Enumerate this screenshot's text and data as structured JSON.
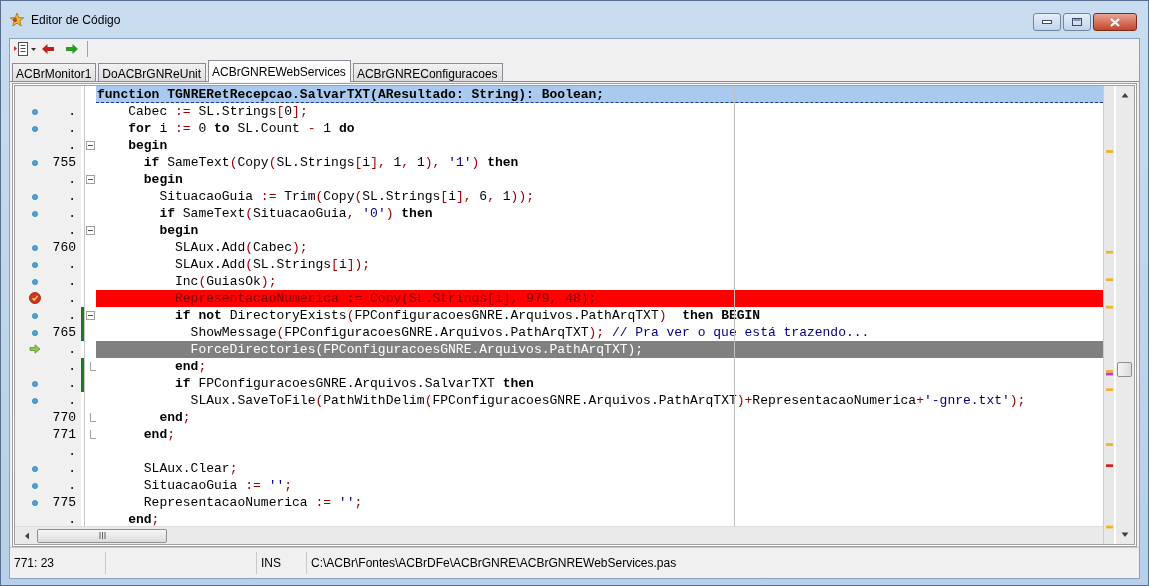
{
  "window": {
    "title": "Editor de Código"
  },
  "tabs": [
    {
      "label": "ACBrMonitor1",
      "selected": false
    },
    {
      "label": "DoACBrGNReUnit",
      "selected": false
    },
    {
      "label": "ACBrGNREWebServices",
      "selected": true
    },
    {
      "label": "ACBrGNREConfiguracoes",
      "selected": false
    }
  ],
  "editor": {
    "lines": [
      {
        "changed": false,
        "highlight": {
          "kind": "header"
        },
        "tokens": [
          {
            "kind": "keyword",
            "text": "function"
          },
          {
            "kind": "plain",
            "text": " TGNRERetRecepcao.SalvarTXT"
          },
          {
            "kind": "symbol",
            "text": "("
          },
          {
            "kind": "plain",
            "text": "AResultado"
          },
          {
            "kind": "symbol",
            "text": ":"
          },
          {
            "kind": "plain",
            "text": " String"
          },
          {
            "kind": "symbol",
            "text": "):"
          },
          {
            "kind": "plain",
            "text": " Boolean"
          },
          {
            "kind": "symbol",
            "text": ";"
          }
        ]
      },
      {
        "number": ".",
        "changed": false,
        "marker": {
          "kind": "dot"
        },
        "tokens": [
          {
            "kind": "plain",
            "text": "    Cabec "
          },
          {
            "kind": "symbol",
            "text": ":="
          },
          {
            "kind": "plain",
            "text": " SL.Strings"
          },
          {
            "kind": "symbol",
            "text": "["
          },
          {
            "kind": "plain",
            "text": "0"
          },
          {
            "kind": "symbol",
            "text": "];"
          }
        ]
      },
      {
        "number": ".",
        "changed": false,
        "marker": {
          "kind": "dot"
        },
        "tokens": [
          {
            "kind": "keyword",
            "text": "    for"
          },
          {
            "kind": "plain",
            "text": " i "
          },
          {
            "kind": "symbol",
            "text": ":="
          },
          {
            "kind": "plain",
            "text": " 0 "
          },
          {
            "kind": "keyword",
            "text": "to"
          },
          {
            "kind": "plain",
            "text": " SL.Count "
          },
          {
            "kind": "symbol",
            "text": "-"
          },
          {
            "kind": "plain",
            "text": " 1 "
          },
          {
            "kind": "keyword",
            "text": "do"
          }
        ]
      },
      {
        "number": ".",
        "changed": false,
        "fold": {
          "kind": "open"
        },
        "tokens": [
          {
            "kind": "keyword",
            "text": "    begin"
          }
        ]
      },
      {
        "number": "755",
        "changed": false,
        "marker": {
          "kind": "dot"
        },
        "tokens": [
          {
            "kind": "keyword",
            "text": "      if"
          },
          {
            "kind": "plain",
            "text": " SameText"
          },
          {
            "kind": "symbol",
            "text": "("
          },
          {
            "kind": "plain",
            "text": "Copy"
          },
          {
            "kind": "symbol",
            "text": "("
          },
          {
            "kind": "plain",
            "text": "SL.Strings"
          },
          {
            "kind": "symbol",
            "text": "["
          },
          {
            "kind": "plain",
            "text": "i"
          },
          {
            "kind": "symbol",
            "text": "],"
          },
          {
            "kind": "plain",
            "text": " 1"
          },
          {
            "kind": "symbol",
            "text": ","
          },
          {
            "kind": "plain",
            "text": " 1"
          },
          {
            "kind": "symbol",
            "text": "), "
          },
          {
            "kind": "string",
            "text": "'1'"
          },
          {
            "kind": "symbol",
            "text": ") "
          },
          {
            "kind": "keyword",
            "text": "then"
          }
        ]
      },
      {
        "number": ".",
        "changed": false,
        "fold": {
          "kind": "open"
        },
        "tokens": [
          {
            "kind": "keyword",
            "text": "      begin"
          }
        ]
      },
      {
        "number": ".",
        "changed": false,
        "marker": {
          "kind": "dot"
        },
        "tokens": [
          {
            "kind": "plain",
            "text": "        SituacaoGuia "
          },
          {
            "kind": "symbol",
            "text": ":="
          },
          {
            "kind": "plain",
            "text": " Trim"
          },
          {
            "kind": "symbol",
            "text": "("
          },
          {
            "kind": "plain",
            "text": "Copy"
          },
          {
            "kind": "symbol",
            "text": "("
          },
          {
            "kind": "plain",
            "text": "SL.Strings"
          },
          {
            "kind": "symbol",
            "text": "["
          },
          {
            "kind": "plain",
            "text": "i"
          },
          {
            "kind": "symbol",
            "text": "],"
          },
          {
            "kind": "plain",
            "text": " 6"
          },
          {
            "kind": "symbol",
            "text": ","
          },
          {
            "kind": "plain",
            "text": " 1"
          },
          {
            "kind": "symbol",
            "text": "));"
          }
        ]
      },
      {
        "number": ".",
        "changed": false,
        "marker": {
          "kind": "dot"
        },
        "tokens": [
          {
            "kind": "keyword",
            "text": "        if"
          },
          {
            "kind": "plain",
            "text": " SameText"
          },
          {
            "kind": "symbol",
            "text": "("
          },
          {
            "kind": "plain",
            "text": "SituacaoGuia"
          },
          {
            "kind": "symbol",
            "text": ", "
          },
          {
            "kind": "string",
            "text": "'0'"
          },
          {
            "kind": "symbol",
            "text": ") "
          },
          {
            "kind": "keyword",
            "text": "then"
          }
        ]
      },
      {
        "number": ".",
        "changed": false,
        "fold": {
          "kind": "open"
        },
        "tokens": [
          {
            "kind": "keyword",
            "text": "        begin"
          }
        ]
      },
      {
        "number": "760",
        "changed": false,
        "marker": {
          "kind": "dot"
        },
        "tokens": [
          {
            "kind": "plain",
            "text": "          SLAux.Add"
          },
          {
            "kind": "symbol",
            "text": "("
          },
          {
            "kind": "plain",
            "text": "Cabec"
          },
          {
            "kind": "symbol",
            "text": ");"
          }
        ]
      },
      {
        "number": ".",
        "changed": false,
        "marker": {
          "kind": "dot"
        },
        "tokens": [
          {
            "kind": "plain",
            "text": "          SLAux.Add"
          },
          {
            "kind": "symbol",
            "text": "("
          },
          {
            "kind": "plain",
            "text": "SL.Strings"
          },
          {
            "kind": "symbol",
            "text": "["
          },
          {
            "kind": "plain",
            "text": "i"
          },
          {
            "kind": "symbol",
            "text": "]);"
          }
        ]
      },
      {
        "number": ".",
        "changed": false,
        "marker": {
          "kind": "dot"
        },
        "tokens": [
          {
            "kind": "plain",
            "text": "          Inc"
          },
          {
            "kind": "symbol",
            "text": "("
          },
          {
            "kind": "plain",
            "text": "GuiasOk"
          },
          {
            "kind": "symbol",
            "text": ");"
          }
        ]
      },
      {
        "number": ".",
        "changed": false,
        "marker": {
          "kind": "breakpoint"
        },
        "highlight": {
          "kind": "error"
        },
        "tokens": [
          {
            "kind": "plain",
            "text": "          RepresentacaoNumerica "
          },
          {
            "kind": "symbol",
            "text": ":="
          },
          {
            "kind": "plain",
            "text": " Copy"
          },
          {
            "kind": "symbol",
            "text": "("
          },
          {
            "kind": "plain",
            "text": "SL.Strings"
          },
          {
            "kind": "symbol",
            "text": "["
          },
          {
            "kind": "plain",
            "text": "i"
          },
          {
            "kind": "symbol",
            "text": "],"
          },
          {
            "kind": "plain",
            "text": " 979"
          },
          {
            "kind": "symbol",
            "text": ","
          },
          {
            "kind": "plain",
            "text": " 48"
          },
          {
            "kind": "symbol",
            "text": ");"
          }
        ]
      },
      {
        "number": ".",
        "changed": true,
        "marker": {
          "kind": "dot"
        },
        "fold": {
          "kind": "open"
        },
        "tokens": [
          {
            "kind": "keyword",
            "text": "          if not"
          },
          {
            "kind": "plain",
            "text": " DirectoryExists"
          },
          {
            "kind": "symbol",
            "text": "("
          },
          {
            "kind": "plain",
            "text": "FPConfiguracoesGNRE.Arquivos.PathArqTXT"
          },
          {
            "kind": "symbol",
            "text": ")  "
          },
          {
            "kind": "keyword",
            "text": "then BEGIN"
          }
        ]
      },
      {
        "number": "765",
        "changed": true,
        "marker": {
          "kind": "dot"
        },
        "tokens": [
          {
            "kind": "plain",
            "text": "            ShowMessage"
          },
          {
            "kind": "symbol",
            "text": "("
          },
          {
            "kind": "plain",
            "text": "FPConfiguracoesGNRE.Arquivos.PathArqTXT"
          },
          {
            "kind": "symbol",
            "text": "); "
          },
          {
            "kind": "comment",
            "text": "// Pra ver o que está trazendo..."
          }
        ]
      },
      {
        "number": ".",
        "changed": false,
        "marker": {
          "kind": "arrow"
        },
        "highlight": {
          "kind": "current"
        },
        "tokens": [
          {
            "kind": "plain",
            "text": "            ForceDirectories"
          },
          {
            "kind": "symbol",
            "text": "("
          },
          {
            "kind": "plain",
            "text": "FPConfiguracoesGNRE.Arquivos.PathArqTXT"
          },
          {
            "kind": "symbol",
            "text": ");"
          }
        ]
      },
      {
        "number": ".",
        "changed": true,
        "fold": {
          "kind": "end"
        },
        "tokens": [
          {
            "kind": "keyword",
            "text": "          end"
          },
          {
            "kind": "symbol",
            "text": ";"
          }
        ]
      },
      {
        "number": ".",
        "changed": true,
        "marker": {
          "kind": "dot"
        },
        "tokens": [
          {
            "kind": "keyword",
            "text": "          if"
          },
          {
            "kind": "plain",
            "text": " FPConfiguracoesGNRE.Arquivos.SalvarTXT "
          },
          {
            "kind": "keyword",
            "text": "then"
          }
        ]
      },
      {
        "number": ".",
        "changed": false,
        "marker": {
          "kind": "dot"
        },
        "tokens": [
          {
            "kind": "plain",
            "text": "            SLAux.SaveToFile"
          },
          {
            "kind": "symbol",
            "text": "("
          },
          {
            "kind": "plain",
            "text": "PathWithDelim"
          },
          {
            "kind": "symbol",
            "text": "("
          },
          {
            "kind": "plain",
            "text": "FPConfiguracoesGNRE.Arquivos.PathArqTXT"
          },
          {
            "kind": "symbol",
            "text": ")+"
          },
          {
            "kind": "plain",
            "text": "RepresentacaoNumerica"
          },
          {
            "kind": "symbol",
            "text": "+"
          },
          {
            "kind": "string",
            "text": "'-gnre.txt'"
          },
          {
            "kind": "symbol",
            "text": ");"
          }
        ]
      },
      {
        "number": "770",
        "changed": false,
        "fold": {
          "kind": "end"
        },
        "tokens": [
          {
            "kind": "keyword",
            "text": "        end"
          },
          {
            "kind": "symbol",
            "text": ";"
          }
        ]
      },
      {
        "number": "771",
        "changed": false,
        "fold": {
          "kind": "end"
        },
        "tokens": [
          {
            "kind": "keyword",
            "text": "      end"
          },
          {
            "kind": "symbol",
            "text": ";"
          }
        ]
      },
      {
        "number": ".",
        "changed": false
      },
      {
        "number": ".",
        "changed": false,
        "marker": {
          "kind": "dot"
        },
        "tokens": [
          {
            "kind": "plain",
            "text": "      SLAux.Clear"
          },
          {
            "kind": "symbol",
            "text": ";"
          }
        ]
      },
      {
        "number": ".",
        "changed": false,
        "marker": {
          "kind": "dot"
        },
        "tokens": [
          {
            "kind": "plain",
            "text": "      SituacaoGuia "
          },
          {
            "kind": "symbol",
            "text": ":= "
          },
          {
            "kind": "string",
            "text": "''"
          },
          {
            "kind": "symbol",
            "text": ";"
          }
        ]
      },
      {
        "number": "775",
        "changed": false,
        "marker": {
          "kind": "dot"
        },
        "tokens": [
          {
            "kind": "plain",
            "text": "      RepresentacaoNumerica "
          },
          {
            "kind": "symbol",
            "text": ":= "
          },
          {
            "kind": "string",
            "text": "''"
          },
          {
            "kind": "symbol",
            "text": ";"
          }
        ]
      },
      {
        "number": ".",
        "changed": false,
        "tokens": [
          {
            "kind": "keyword",
            "text": "    end"
          },
          {
            "kind": "symbol",
            "text": ";"
          }
        ]
      }
    ]
  },
  "status_bar": {
    "position": "771: 23",
    "mode": "INS",
    "file_path": "C:\\ACBr\\Fontes\\ACBrDFe\\ACBrGNRE\\ACBrGNREWebServices.pas"
  }
}
